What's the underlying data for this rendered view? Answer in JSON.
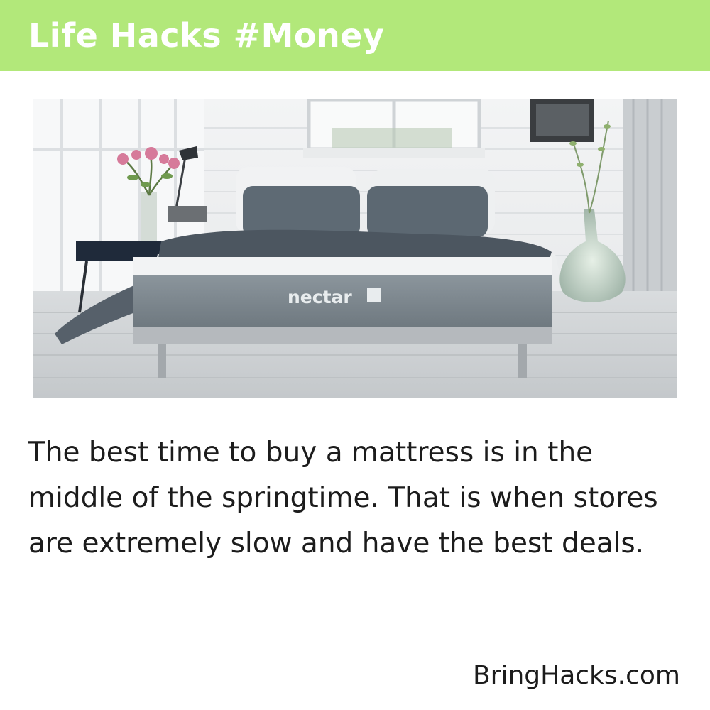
{
  "header": {
    "title": "Life Hacks #Money",
    "background_color": "#b2e87a"
  },
  "photo": {
    "brand_label": "nectar"
  },
  "tip": {
    "text": "The best time to buy a mattress is in the middle of the springtime. That is when stores are extremely slow and have the best deals."
  },
  "footer": {
    "site": "BringHacks.com"
  }
}
